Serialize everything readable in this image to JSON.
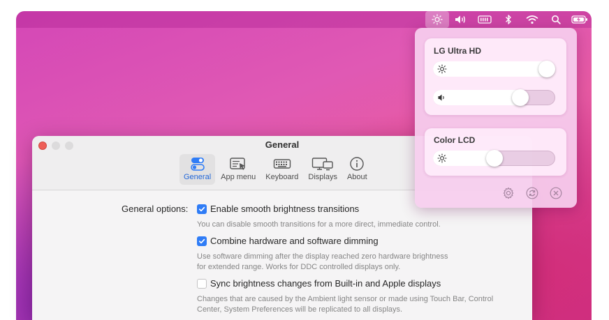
{
  "menubar": {
    "items": [
      "brightness-icon",
      "volume-icon",
      "battery-box-icon",
      "bluetooth-icon",
      "wifi-icon",
      "search-icon",
      "battery-icon"
    ]
  },
  "window": {
    "title": "General",
    "toolbar": [
      {
        "label": "General",
        "icon": "toggles-icon",
        "selected": true
      },
      {
        "label": "App menu",
        "icon": "app-menu-icon",
        "selected": false
      },
      {
        "label": "Keyboard",
        "icon": "keyboard-icon",
        "selected": false
      },
      {
        "label": "Displays",
        "icon": "displays-icon",
        "selected": false
      },
      {
        "label": "About",
        "icon": "info-icon",
        "selected": false
      }
    ],
    "general_options_label": "General options:",
    "options": [
      {
        "label": "Enable smooth brightness transitions",
        "checked": true,
        "description": [
          "You can disable smooth transitions for a more direct, immediate control."
        ]
      },
      {
        "label": "Combine hardware and software dimming",
        "checked": true,
        "description": [
          "Use software dimming after the display reached zero hardware brightness",
          "for extended range. Works for DDC controlled displays only."
        ]
      },
      {
        "label": "Sync brightness changes from Built-in and Apple displays",
        "checked": false,
        "description": [
          "Changes that are caused by the Ambient light sensor or made using Touch Bar, Control",
          "Center, System Preferences will be replicated to all displays."
        ]
      }
    ]
  },
  "popover": {
    "displays": [
      {
        "name": "LG Ultra HD",
        "brightness": 1.0,
        "volume": 0.75
      },
      {
        "name": "Color LCD",
        "brightness": 0.5
      }
    ]
  },
  "colors": {
    "accent": "#2f7cf6",
    "selected_tab_text": "#2166d8",
    "close_button": "#ee5f58"
  }
}
